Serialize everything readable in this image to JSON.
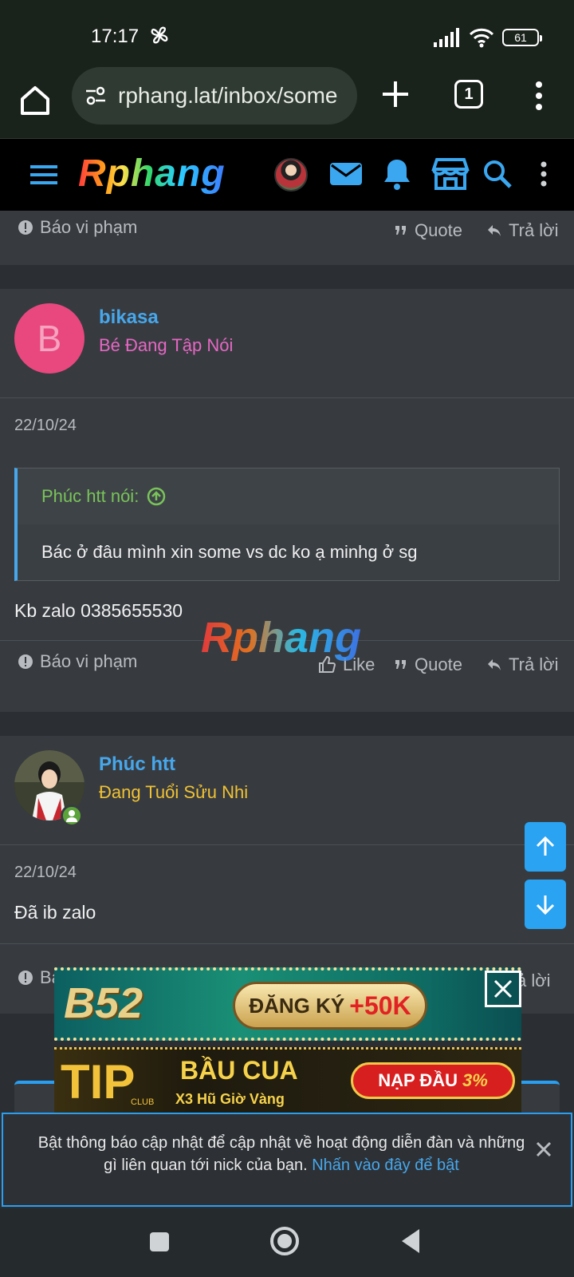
{
  "status": {
    "time": "17:17",
    "battery": "61"
  },
  "browser": {
    "url": "rphang.lat/inbox/some",
    "tab_count": "1"
  },
  "site": {
    "logo": "Rphang"
  },
  "actions": {
    "report": "Báo vi phạm",
    "like": "Like",
    "quote": "Quote",
    "reply": "Trả lời",
    "report_partial": "Ba",
    "reply_partial": "ả lời"
  },
  "posts": [
    {
      "avatar_letter": "B",
      "username": "bikasa",
      "user_title": "Bé Đang Tập Nói",
      "date": "22/10/24",
      "quote_author": "Phúc htt nói:",
      "quote_text": "Bác ở đâu mình xin some vs dc ko ạ minhg ở sg",
      "text": "Kb zalo 0385655530"
    },
    {
      "username": "Phúc htt",
      "user_title": "Đang Tuổi Sửu Nhi",
      "date": "22/10/24",
      "text": "Đã ib zalo"
    }
  ],
  "watermark": "Rphang",
  "ads": {
    "ad1": {
      "brand": "B52",
      "cta": "ĐĂNG KÝ",
      "bonus": "+50K"
    },
    "ad2": {
      "brand": "TIP",
      "club": "CLUB",
      "title": "BẦU CUA",
      "subtitle": "X3 Hũ Giờ Vàng",
      "cta": "NẠP ĐẦU",
      "bonus": "3%"
    }
  },
  "notice": {
    "text": "Bật thông báo cập nhật để cập nhật về hoạt động diễn đàn và những gì liên quan tới nick của bạn. ",
    "link": "Nhấn vào đây để bật"
  },
  "colors": {
    "accent": "#47a7eb",
    "title_pink": "#e667c4",
    "title_gold": "#f1c232",
    "avatar_pink": "#e8487d"
  }
}
